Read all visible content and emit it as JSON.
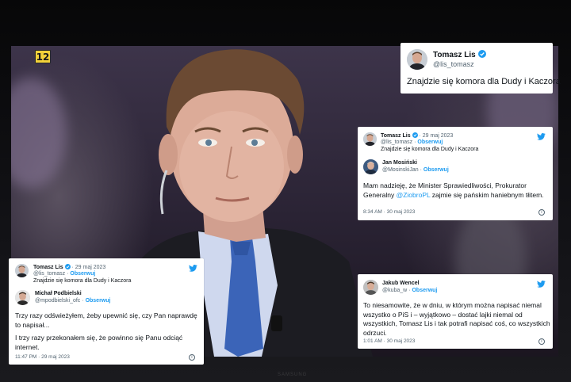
{
  "channel": {
    "logo": "12"
  },
  "tv": {
    "brand": "SAMSUNG"
  },
  "colors": {
    "accent": "#1d9bf0",
    "text": "#0f1419",
    "muted": "#536471"
  },
  "main_tweet": {
    "name": "Tomasz Lis",
    "handle": "@lis_tomasz",
    "text": "Znajdzie się komora dla Dudy i Kaczora",
    "icon": "verified-badge-icon"
  },
  "reply_card_1": {
    "quoted": {
      "name": "Tomasz Lis",
      "date_sep": "· 29 maj 2023",
      "handle": "@lis_tomasz",
      "follow": "Obserwuj",
      "text": "Znajdzie się komora dla Dudy i Kaczora"
    },
    "reply": {
      "name": "Jan Mosiński",
      "handle": "@MosinskiJan",
      "sep": "·",
      "follow": "Obserwuj",
      "text_before": "Mam nadzieję, że Minister Sprawiedliwości, Prokurator Generalny ",
      "mention": "@ZiobroPL",
      "text_after": " zajmie się pańskim haniebnym tłitem.",
      "timestamp": "8:34 AM · 30 maj 2023"
    }
  },
  "reply_card_2": {
    "quoted": {
      "name": "Tomasz Lis",
      "date_sep": "· 29 maj 2023",
      "handle": "@lis_tomasz",
      "follow": "Obserwuj",
      "text": "Znajdzie się komora dla Dudy i Kaczora"
    },
    "reply": {
      "name": "Michał Podbielski",
      "handle": "@mpodbielski_ofc",
      "sep": "·",
      "follow": "Obserwuj",
      "text1": "Trzy razy odświeżyłem, żeby upewnić się, czy Pan naprawdę to napisał...",
      "text2": "I trzy razy przekonałem się, że powinno się Panu odciąć internet.",
      "timestamp": "11:47 PM · 29 maj 2023"
    }
  },
  "reply_card_3": {
    "name": "Jakub Wencel",
    "handle": "@kuba_w",
    "sep": "·",
    "follow": "Obserwuj",
    "text": "To niesamowite, że w dniu, w którym można napisać niemal wszystko o PiS i – wyjątkowo – dostać lajki niemal od wszystkich, Tomasz Lis i tak potrafi napisać coś, co wszystkich odrzuci.",
    "timestamp": "1:01 AM · 30 maj 2023"
  }
}
